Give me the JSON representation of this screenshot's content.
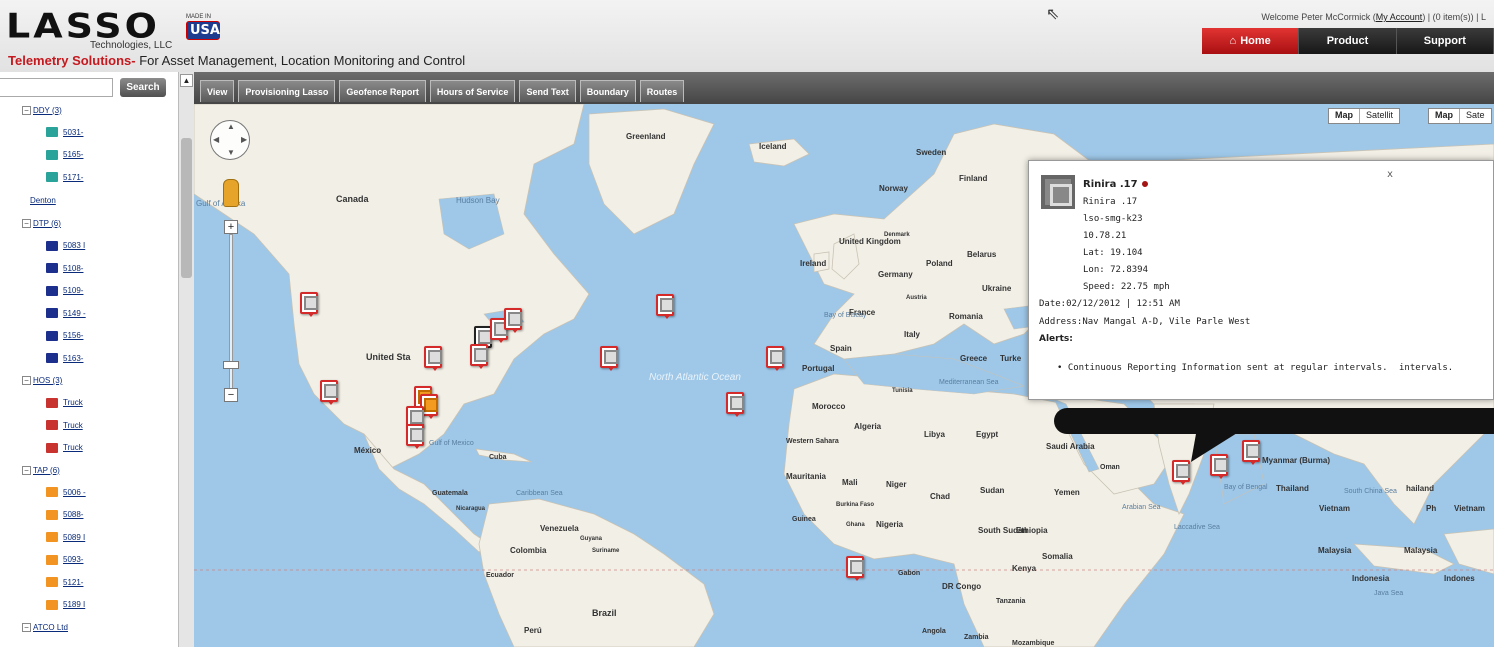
{
  "header": {
    "logo_text": "LASSO",
    "logo_sub": "Technologies, LLC",
    "made_in": "MADE IN",
    "usa": "USA",
    "tagline_red": "Telemetry Solutions-",
    "tagline_rest": " For Asset Management, Location Monitoring and Control",
    "welcome_prefix": "Welcome Peter McCormick (",
    "my_account": "My Account",
    "welcome_suffix": ") | (0 item(s)) | L"
  },
  "nav": {
    "home": "Home",
    "product": "Product",
    "support": "Support",
    "active_color": "#c4191f"
  },
  "sidebar": {
    "search_placeholder": "",
    "search_button": "Search",
    "groups": [
      {
        "label": "DDY (3)",
        "items": [
          {
            "label": "5031-",
            "color": "#2aa39a"
          },
          {
            "label": "5165-",
            "color": "#2aa39a"
          },
          {
            "label": "5171-",
            "color": "#2aa39a"
          }
        ]
      },
      {
        "plain": "Denton"
      },
      {
        "label": "DTP (6)",
        "items": [
          {
            "label": "5083 I",
            "color": "#1d2f8c"
          },
          {
            "label": "5108-",
            "color": "#1d2f8c"
          },
          {
            "label": "5109-",
            "color": "#1d2f8c"
          },
          {
            "label": "5149 -",
            "color": "#1d2f8c"
          },
          {
            "label": "5156-",
            "color": "#1d2f8c"
          },
          {
            "label": "5163-",
            "color": "#1d2f8c"
          }
        ]
      },
      {
        "label": "HOS (3)",
        "items": [
          {
            "label": "Truck",
            "color": "#c8322f"
          },
          {
            "label": "Truck",
            "color": "#c8322f"
          },
          {
            "label": "Truck",
            "color": "#c8322f"
          }
        ]
      },
      {
        "label": "TAP (6)",
        "items": [
          {
            "label": "5006 -",
            "color": "#f29422"
          },
          {
            "label": "5088-",
            "color": "#f29422"
          },
          {
            "label": "5089 I",
            "color": "#f29422"
          },
          {
            "label": "5093-",
            "color": "#f29422"
          },
          {
            "label": "5121-",
            "color": "#f29422"
          },
          {
            "label": "5189 I",
            "color": "#f29422"
          }
        ]
      },
      {
        "label": "ATCO Ltd",
        "items": []
      }
    ]
  },
  "tabs": [
    "View",
    "Provisioning Lasso",
    "Geofence Report",
    "Hours of Service",
    "Send Text",
    "Boundary",
    "Routes"
  ],
  "map": {
    "map_type_map": "Map",
    "map_type_sat1": "Satellit",
    "map_type_sat2": "Sate",
    "labels": {
      "greenland": "Greenland",
      "iceland": "Iceland",
      "sweden": "Sweden",
      "finland": "Finland",
      "norway": "Norway",
      "canada": "Canada",
      "hudson": "Hudson Bay",
      "alaska": "Gulf of Alaska",
      "uk": "United Kingdom",
      "ireland": "Ireland",
      "denmark": "Denmark",
      "poland": "Poland",
      "belarus": "Belarus",
      "germany": "Germany",
      "ukraine": "Ukraine",
      "france": "France",
      "romania": "Romania",
      "italy": "Italy",
      "spain": "Spain",
      "portugal": "Portugal",
      "greece": "Greece",
      "turkey": "Turke",
      "us": "United Sta",
      "mexico": "México",
      "gulf_mexico": "Gulf of Mexico",
      "cuba": "Cuba",
      "north_atlantic": "North Atlantic Ocean",
      "morocco": "Morocco",
      "western_sahara": "Western Sahara",
      "algeria": "Algeria",
      "libya": "Libya",
      "egypt": "Egypt",
      "saudi": "Saudi Arabia",
      "mauritania": "Mauritania",
      "mali": "Mali",
      "niger": "Niger",
      "chad": "Chad",
      "sudan": "Sudan",
      "yemen": "Yemen",
      "oman": "Oman",
      "guinea": "Guinea",
      "burkina": "Burkina Faso",
      "ghana": "Ghana",
      "nigeria": "Nigeria",
      "south_sudan": "South Sudan",
      "ethiopia": "Ethiopia",
      "somalia": "Somalia",
      "kenya": "Kenya",
      "gabon": "Gabon",
      "drc": "DR Congo",
      "tanzania": "Tanzania",
      "angola": "Angola",
      "zambia": "Zambia",
      "mozambique": "Mozambique",
      "guatemala": "Guatemala",
      "nicaragua": "Nicaragua",
      "venezuela": "Venezuela",
      "colombia": "Colombia",
      "guyana": "Guyana",
      "suriname": "Suriname",
      "ecuador": "Ecuador",
      "brazil": "Brazil",
      "peru": "Perú",
      "myanmar": "Myanmar (Burma)",
      "thailand": "Thailand",
      "vietnam": "Vietnam",
      "vietnam2": "Vietnam",
      "malaysia": "Malaysia",
      "malaysia2": "Malaysia",
      "indonesia": "Indonesia",
      "indonesia2": "Indones",
      "thailand2": "hailand",
      "ph": "Ph",
      "bay_bengal": "Bay of Bengal",
      "arabian": "Arabian Sea",
      "laccadive": "Laccadive Sea",
      "java": "Java Sea",
      "scs": "South China Sea",
      "caribbean": "Caribbean Sea",
      "bay_biscay": "Bay of Biscay",
      "med": "Mediterranean Sea",
      "austria": "Austria",
      "tunisia": "Tunisia"
    }
  },
  "popup": {
    "title": "Rinira .17",
    "name": "Rinira .17",
    "device": "lso-smg-k23",
    "ip": "10.78.21",
    "lat": "Lat: 19.104",
    "lon": "Lon: 72.8394",
    "speed": "Speed: 22.75 mph",
    "date": "Date:02/12/2012 | 12:51 AM",
    "address": "Address:Nav Mangal A-D, Vile Parle West",
    "alerts_label": "Alerts:",
    "alert_item": "Continuous Reporting Information sent at regular intervals.",
    "alert_dup": "intervals.",
    "close": "x"
  }
}
